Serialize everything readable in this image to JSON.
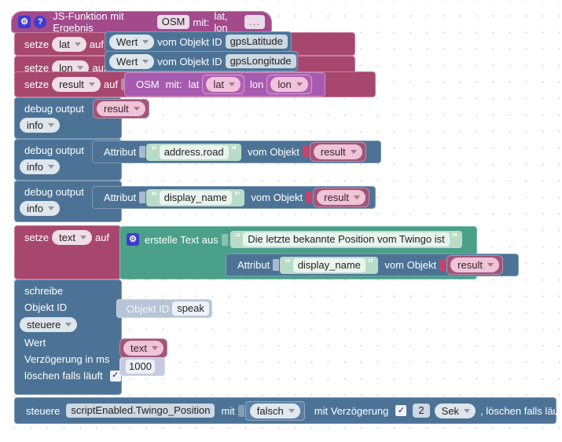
{
  "app": {
    "editor": "blockly-script-editor",
    "language": "de"
  },
  "header": {
    "gear_icon": "gear-icon",
    "help_icon": "help-icon",
    "title": "JS-Funktion mit Ergebnis",
    "name_field": "OSM",
    "with_label": "mit:",
    "params": "lat, lon",
    "more_field": "..."
  },
  "set_lat": {
    "set_label": "setze",
    "variable": "lat",
    "to_label": "auf",
    "value": {
      "selector": "Wert",
      "from_label": "vom Objekt ID",
      "object_id": "gpsLatitude"
    }
  },
  "set_lon": {
    "set_label": "setze",
    "variable": "lon",
    "to_label": "auf",
    "value": {
      "selector": "Wert",
      "from_label": "vom Objekt ID",
      "object_id": "gpsLongitude"
    }
  },
  "set_result": {
    "set_label": "setze",
    "variable": "result",
    "to_label": "auf",
    "call": {
      "function": "OSM",
      "with_label": "mit:",
      "args": [
        {
          "name": "lat",
          "value": "lat"
        },
        {
          "name": "lon",
          "value": "lon"
        }
      ]
    }
  },
  "debug_blocks": [
    {
      "label": "debug output",
      "severity": "info",
      "kind": "variable",
      "variable": "result"
    },
    {
      "label": "debug output",
      "severity": "info",
      "kind": "attribute",
      "attribute_label": "Attribut",
      "attribute": "address.road",
      "from_label": "vom Objekt",
      "object": "result"
    },
    {
      "label": "debug output",
      "severity": "info",
      "kind": "attribute",
      "attribute_label": "Attribut",
      "attribute": "display_name",
      "from_label": "vom Objekt",
      "object": "result"
    }
  ],
  "set_text": {
    "set_label": "setze",
    "variable": "text",
    "to_label": "auf",
    "create_text": {
      "gear_icon": "gear-icon",
      "label": "erstelle Text aus",
      "items": [
        {
          "kind": "string",
          "value": "Die letzte bekannte Position vom Twingo ist"
        },
        {
          "kind": "attribute",
          "attribute_label": "Attribut",
          "attribute": "display_name",
          "from_label": "vom Objekt",
          "object": "result"
        }
      ]
    }
  },
  "write_block": {
    "title": "schreibe",
    "object_id_label": "Objekt ID",
    "object_id_chip_label": "Objekt ID",
    "object_id_value": "speak",
    "mode": "steuere",
    "value_label": "Wert",
    "value_variable": "text",
    "delay_label": "Verzögerung in ms",
    "delay_value": "1000",
    "clear_label": "löschen falls läuft",
    "clear_checked": "✓"
  },
  "control_block": {
    "control_label": "steuere",
    "object_id": "scriptEnabled.Twingo_Position",
    "with_label": "mit",
    "value": "falsch",
    "delay_label": "mit Verzögerung",
    "delay_checked": "✓",
    "delay_amount": "2",
    "delay_unit": "Sek",
    "clear_label": ", löschen falls läuft",
    "clear_checked": ""
  },
  "colors": {
    "canvas": "#ffffff",
    "hat": "#a24a8c",
    "set_variable": "#a8476e",
    "getter_blue": "#4c7396",
    "light_blue": "#b7c5d6",
    "text_green": "#4aa089",
    "string_green": "#b9dcc8",
    "variable_ref": "#a1547a",
    "icon_blue": "#3f3ad0"
  }
}
